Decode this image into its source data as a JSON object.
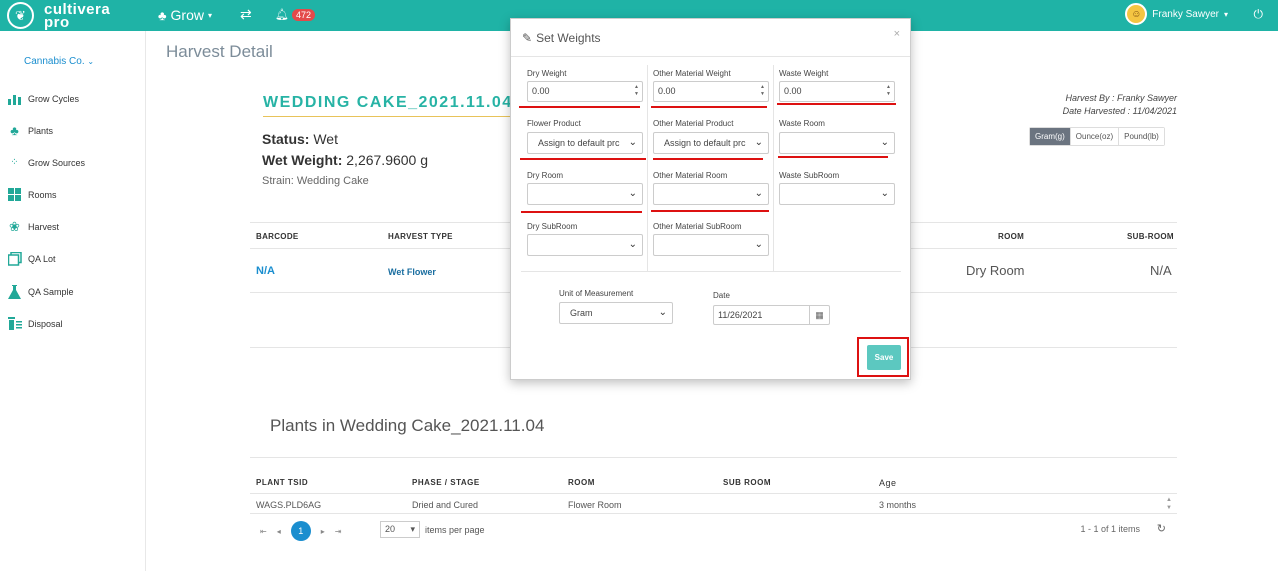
{
  "header": {
    "logo_line1": "cultivera",
    "logo_line2": "pro",
    "nav_grow": "Grow",
    "notifications": "472",
    "user_name": "Franky Sawyer"
  },
  "sidebar": {
    "company": "Cannabis Co.",
    "items": [
      {
        "label": "Grow Cycles",
        "icon": "bar-chart-icon"
      },
      {
        "label": "Plants",
        "icon": "tree-icon"
      },
      {
        "label": "Grow Sources",
        "icon": "seeds-icon"
      },
      {
        "label": "Rooms",
        "icon": "grid-icon"
      },
      {
        "label": "Harvest",
        "icon": "harvest-icon"
      },
      {
        "label": "QA Lot",
        "icon": "copy-icon"
      },
      {
        "label": "QA Sample",
        "icon": "flask-icon"
      },
      {
        "label": "Disposal",
        "icon": "trash-icon"
      }
    ]
  },
  "page": {
    "title": "Harvest Detail",
    "harvest_name": "WEDDING CAKE_2021.11.04",
    "status_label": "Status:",
    "status_value": "Wet",
    "wet_weight_label": "Wet Weight:",
    "wet_weight_value": "2,267.9600 g",
    "strain": "Strain: Wedding Cake",
    "harvest_by": "Harvest By : Franky Sawyer",
    "date_harvested": "Date Harvested : 11/04/2021",
    "units": [
      "Gram(g)",
      "Ounce(oz)",
      "Pound(lb)"
    ],
    "table": {
      "headers": [
        "BARCODE",
        "HARVEST TYPE",
        "ROOM",
        "SUB-ROOM"
      ],
      "row": [
        "N/A",
        "Wet Flower",
        "Dry Room",
        "N/A"
      ]
    },
    "plants_title": "Plants in Wedding Cake_2021.11.04",
    "plants_table": {
      "headers": [
        "PLANT TSID",
        "PHASE / STAGE",
        "ROOM",
        "SUB ROOM",
        "Age"
      ],
      "row": [
        "WAGS.PLD6AG",
        "Dried and Cured",
        "Flower Room",
        "",
        "3 months"
      ]
    },
    "pager": {
      "current_page": "1",
      "per_page": "20",
      "per_page_label": "items per page",
      "count": "1 - 1 of 1 items"
    }
  },
  "modal": {
    "title": "Set Weights",
    "dry_weight_label": "Dry Weight",
    "dry_weight_value": "0.00",
    "other_weight_label": "Other Material Weight",
    "other_weight_value": "0.00",
    "waste_weight_label": "Waste Weight",
    "waste_weight_value": "0.00",
    "flower_product_label": "Flower Product",
    "flower_product_value": "Assign to default prc",
    "other_product_label": "Other Material Product",
    "other_product_value": "Assign to default prc",
    "waste_room_label": "Waste Room",
    "dry_room_label": "Dry Room",
    "other_room_label": "Other Material Room",
    "waste_subroom_label": "Waste SubRoom",
    "dry_subroom_label": "Dry SubRoom",
    "other_subroom_label": "Other Material SubRoom",
    "uom_label": "Unit of Measurement",
    "uom_value": "Gram",
    "date_label": "Date",
    "date_value": "11/26/2021",
    "save_label": "Save"
  },
  "colors": {
    "brand": "#1fb3a6",
    "link": "#1a8ecf",
    "highlight": "#dd1111",
    "save": "#5cc8c0"
  }
}
